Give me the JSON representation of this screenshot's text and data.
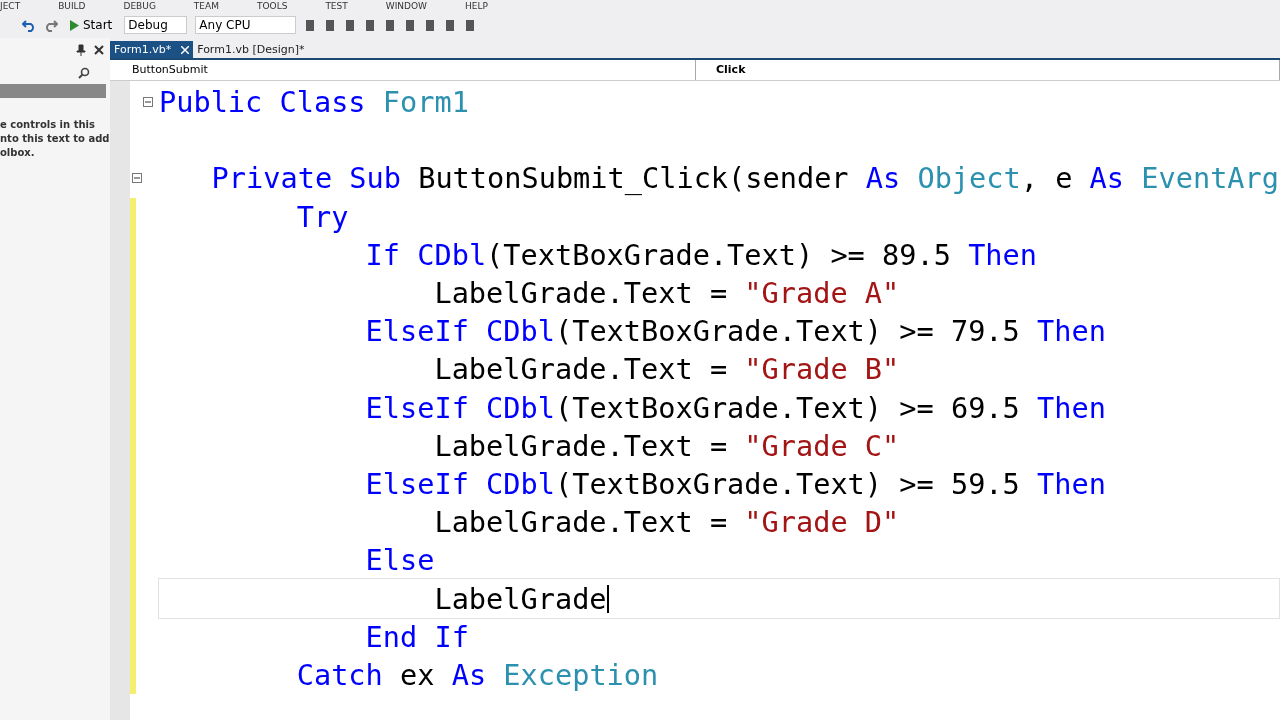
{
  "menu": [
    "JECT",
    "BUILD",
    "DEBUG",
    "TEAM",
    "TOOLS",
    "TEST",
    "WINDOW",
    "HELP"
  ],
  "toolbar": {
    "start": "Start",
    "config": "Debug",
    "platform": "Any CPU"
  },
  "tabs": [
    {
      "label": "Form1.vb*",
      "selected": true
    },
    {
      "label": "Form1.vb [Design]*",
      "selected": false
    }
  ],
  "nav": {
    "object": "ButtonSubmit",
    "event": "Click"
  },
  "toolbox": {
    "text": "e controls in this\nnto this text to add\nolbox."
  },
  "lines": [
    {
      "collapsible": true,
      "changed": false,
      "current": false,
      "tokens": [
        {
          "kind": "keyword",
          "t": "Public Class "
        },
        {
          "kind": "type",
          "t": "Form1"
        }
      ]
    },
    {
      "collapsible": false,
      "changed": false,
      "current": false
    },
    {
      "collapsible": true,
      "changed": false,
      "current": false,
      "tokens": [
        {
          "kind": "keyword",
          "t": "    Private Sub "
        },
        {
          "kind": "plain",
          "t": "ButtonSubmit_Click(sender "
        },
        {
          "kind": "keyword",
          "t": "As "
        },
        {
          "kind": "type",
          "t": "Object"
        },
        {
          "kind": "plain",
          "t": ", e "
        },
        {
          "kind": "keyword",
          "t": "As "
        },
        {
          "kind": "type",
          "t": "EventArg"
        }
      ]
    },
    {
      "collapsible": false,
      "changed": true,
      "current": false,
      "tokens": [
        {
          "kind": "keyword",
          "t": "        Try"
        }
      ]
    },
    {
      "collapsible": false,
      "changed": true,
      "current": false,
      "tokens": [
        {
          "kind": "keyword",
          "t": "            If "
        },
        {
          "kind": "keyword",
          "t": "CDbl"
        },
        {
          "kind": "plain",
          "t": "(TextBoxGrade.Text) >= 89.5 "
        },
        {
          "kind": "keyword",
          "t": "Then"
        }
      ]
    },
    {
      "collapsible": false,
      "changed": true,
      "current": false,
      "tokens": [
        {
          "kind": "plain",
          "t": "                LabelGrade.Text = "
        },
        {
          "kind": "string",
          "t": "\"Grade A\""
        }
      ]
    },
    {
      "collapsible": false,
      "changed": true,
      "current": false,
      "tokens": [
        {
          "kind": "keyword",
          "t": "            ElseIf "
        },
        {
          "kind": "keyword",
          "t": "CDbl"
        },
        {
          "kind": "plain",
          "t": "(TextBoxGrade.Text) >= 79.5 "
        },
        {
          "kind": "keyword",
          "t": "Then"
        }
      ]
    },
    {
      "collapsible": false,
      "changed": true,
      "current": false,
      "tokens": [
        {
          "kind": "plain",
          "t": "                LabelGrade.Text = "
        },
        {
          "kind": "string",
          "t": "\"Grade B\""
        }
      ]
    },
    {
      "collapsible": false,
      "changed": true,
      "current": false,
      "tokens": [
        {
          "kind": "keyword",
          "t": "            ElseIf "
        },
        {
          "kind": "keyword",
          "t": "CDbl"
        },
        {
          "kind": "plain",
          "t": "(TextBoxGrade.Text) >= 69.5 "
        },
        {
          "kind": "keyword",
          "t": "Then"
        }
      ]
    },
    {
      "collapsible": false,
      "changed": true,
      "current": false,
      "tokens": [
        {
          "kind": "plain",
          "t": "                LabelGrade.Text = "
        },
        {
          "kind": "string",
          "t": "\"Grade C\""
        }
      ]
    },
    {
      "collapsible": false,
      "changed": true,
      "current": false,
      "tokens": [
        {
          "kind": "keyword",
          "t": "            ElseIf "
        },
        {
          "kind": "keyword",
          "t": "CDbl"
        },
        {
          "kind": "plain",
          "t": "(TextBoxGrade.Text) >= 59.5 "
        },
        {
          "kind": "keyword",
          "t": "Then"
        }
      ]
    },
    {
      "collapsible": false,
      "changed": true,
      "current": false,
      "tokens": [
        {
          "kind": "plain",
          "t": "                LabelGrade.Text = "
        },
        {
          "kind": "string",
          "t": "\"Grade D\""
        }
      ]
    },
    {
      "collapsible": false,
      "changed": true,
      "current": false,
      "tokens": [
        {
          "kind": "keyword",
          "t": "            Else"
        }
      ]
    },
    {
      "collapsible": false,
      "changed": true,
      "current": true,
      "tokens": [
        {
          "kind": "plain",
          "t": "                LabelGrade"
        }
      ]
    },
    {
      "collapsible": false,
      "changed": true,
      "current": false,
      "tokens": [
        {
          "kind": "keyword",
          "t": "            End If"
        }
      ]
    },
    {
      "collapsible": false,
      "changed": true,
      "current": false,
      "tokens": [
        {
          "kind": "keyword",
          "t": "        Catch "
        },
        {
          "kind": "plain",
          "t": "ex "
        },
        {
          "kind": "keyword",
          "t": "As "
        },
        {
          "kind": "type",
          "t": "Exception"
        }
      ]
    }
  ]
}
